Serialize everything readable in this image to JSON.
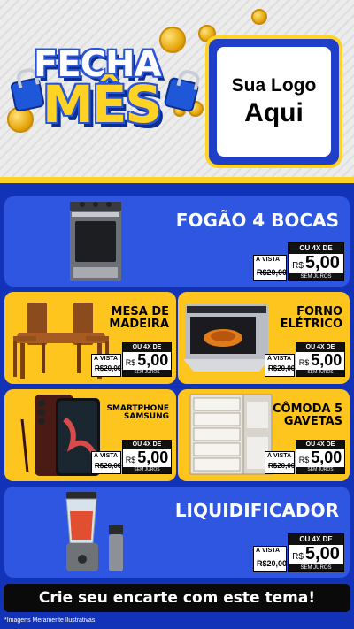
{
  "header": {
    "title_line1": "FECHA",
    "title_line2": "MÊS",
    "logo_line1": "Sua Logo",
    "logo_line2": "Aqui"
  },
  "price_labels": {
    "avista": "À VISTA",
    "old_price": "R$20,00",
    "installments": "OU 4X DE",
    "currency": "R$",
    "value": "5,00",
    "no_interest": "SEM JUROS"
  },
  "products": [
    {
      "name": "FOGÃO 4 BOCAS",
      "icon": "stove-icon"
    },
    {
      "name": "MESA DE MADEIRA",
      "icon": "table-icon"
    },
    {
      "name": "FORNO ELÉTRICO",
      "icon": "oven-icon"
    },
    {
      "name": "SMARTPHONE SAMSUNG",
      "icon": "smartphone-icon"
    },
    {
      "name": "CÔMODA 5 GAVETAS",
      "icon": "dresser-icon"
    },
    {
      "name": "LIQUIDIFICADOR",
      "icon": "blender-icon"
    }
  ],
  "footer": {
    "cta": "Crie seu encarte com este tema!",
    "disclaimer": "*Imagens Meramente Ilustrativas"
  },
  "colors": {
    "blue": "#1233b8",
    "card_blue": "#2e56e0",
    "yellow": "#ffc51f",
    "brand_yellow": "#ffd323"
  }
}
